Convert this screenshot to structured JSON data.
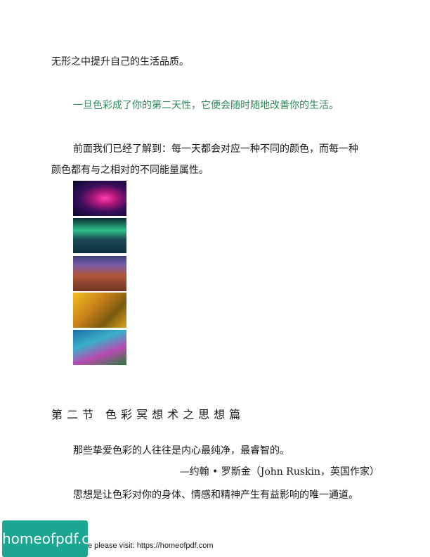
{
  "paragraphs": {
    "line1": "无形之中提升自己的生活品质。",
    "highlight": "一旦色彩成了你的第二天性，它便会随时随地改善你的生活。",
    "line3": "前面我们已经了解到：每一天都会对应一种不同的颜色，而每一种",
    "line4": "颜色都有与之相对的不同能量属性。"
  },
  "images": [
    {
      "name": "nebula-image"
    },
    {
      "name": "aurora-image"
    },
    {
      "name": "canyon-image"
    },
    {
      "name": "autumn-forest-image"
    },
    {
      "name": "coral-reef-image"
    }
  ],
  "section": {
    "heading": "第二节 色彩冥想术之思想篇",
    "quote": "那些挚爱色彩的人往往是内心最纯净，最睿智的。",
    "attribution": "—约翰 • 罗斯金（John Ruskin，英国作家）",
    "body": "思想是让色彩对你的身体、情感和精神产生有益影响的唯一通道。"
  },
  "footer": {
    "logo_text": "homeofpdf.com",
    "text": "e please visit: https://homeofpdf.com"
  },
  "colors": {
    "highlight_text": "#2e8b57",
    "logo_background": "#1aa690"
  }
}
